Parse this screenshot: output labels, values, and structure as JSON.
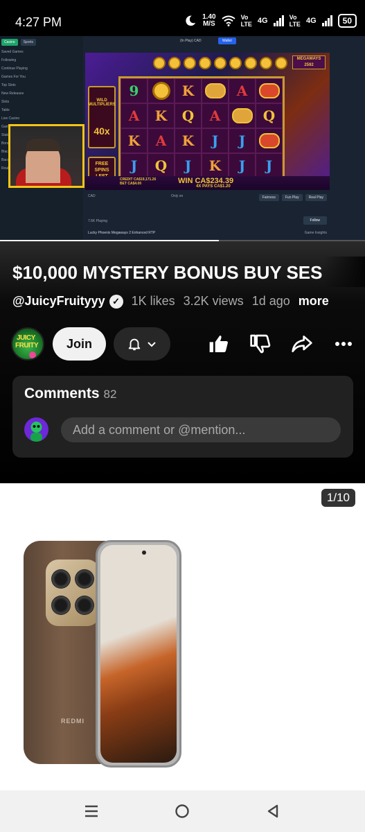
{
  "status_bar": {
    "time": "4:27 PM",
    "speed_value": "1.40",
    "speed_unit": "M/S",
    "sim1_a": "Vo",
    "sim1_b": "LTE",
    "sim1_net": "4G",
    "sim2_a": "Vo",
    "sim2_b": "LTE",
    "sim2_net": "4G",
    "battery": "50"
  },
  "video": {
    "casino_tab": "Casino",
    "sports_tab": "Sports",
    "nav_items": [
      "Saved Games",
      "Following",
      "Continue Playing",
      "Games For You",
      "Top Slots",
      "New Releases",
      "Slots",
      "Table",
      "Live Casino",
      "Game Shows",
      "Stake Poker",
      "Bonus Buy",
      "Blackjack",
      "Baccarat",
      "Roulette"
    ],
    "topbar_balance": "(In Play) CAD",
    "wallet_label": "Wallet",
    "wild_label": "WILD MULTIPLIERS",
    "wild_mult": "40x",
    "free_spins_label": "FREE SPINS LEFT",
    "free_spins_count": "14",
    "megaways_label": "MEGAWAYS",
    "megaways_value": "2592",
    "credit_line": "CREDIT CA$19,171.26",
    "bet_line": "BET CA$4.00",
    "win_label": "WIN CA$234.39",
    "pays_label": "4X  PAYS CA$1.20",
    "reels": [
      [
        "9",
        "coin",
        "K",
        "pig",
        "A",
        "lion"
      ],
      [
        "A",
        "K",
        "Q",
        "A",
        "pig",
        "Q"
      ],
      [
        "K",
        "A",
        "K",
        "J",
        "J",
        "lion"
      ],
      [
        "J",
        "Q",
        "J",
        "K",
        "J",
        "J"
      ]
    ],
    "currency_select": "CAD",
    "only_on": "Only on",
    "fairness_btn": "Fairness",
    "fun_play_btn": "Fun Play",
    "real_play_btn": "Real Play",
    "follow_btn": "Follow",
    "game_title": "Lucky Phoenix Megaways 2 Enhanced RTP",
    "game_insights": "Game Insights",
    "playing_count": "7.6K Playing",
    "progress_fraction": 0.6
  },
  "info": {
    "title": "$10,000 MYSTERY BONUS BUY SES",
    "handle": "@JuicyFruityyy",
    "likes": "1K likes",
    "views": "3.2K views",
    "age": "1d ago",
    "more": "more",
    "join": "Join",
    "avatar_line1": "JUICY",
    "avatar_line2": "FRUITY"
  },
  "comments": {
    "title": "Comments",
    "count": "82",
    "placeholder": "Add a comment or @mention..."
  },
  "ad": {
    "counter": "1/10",
    "brand": "REDMI"
  },
  "colors": {
    "join_bg": "#f1f1f1",
    "bell_bg": "#272727",
    "comments_bg": "#212121",
    "accent_gold": "#f3c13a",
    "webcam_border": "#f5c518"
  }
}
